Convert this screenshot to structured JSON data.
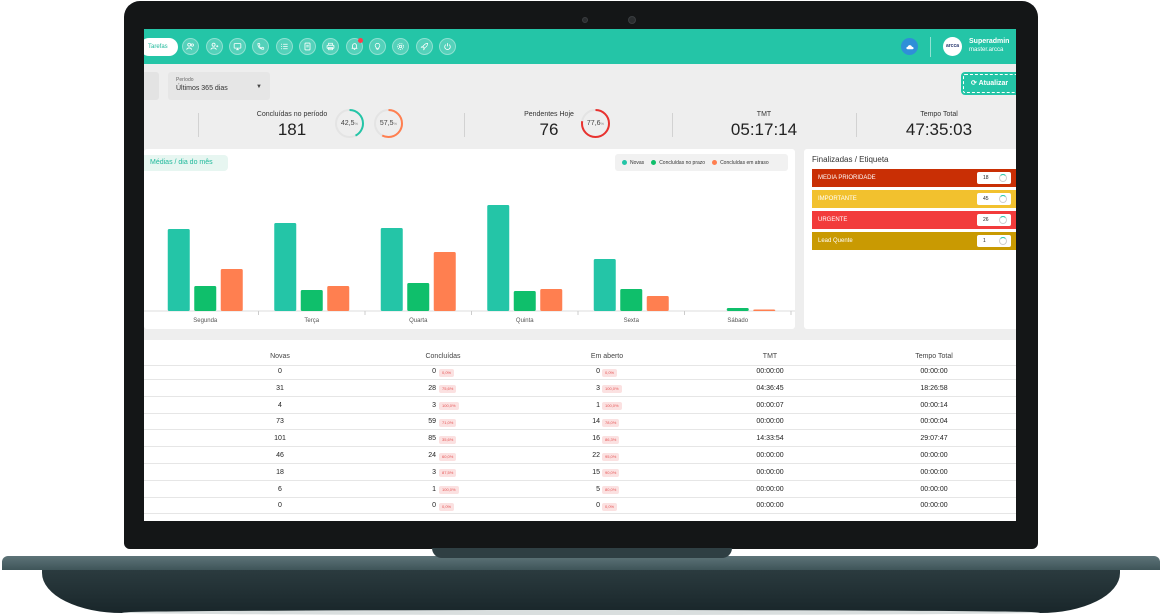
{
  "header": {
    "tasks_label": "Tarefas",
    "icons": [
      "users-icon",
      "user-plus-icon",
      "monitor-icon",
      "phone-icon",
      "list-icon",
      "document-icon",
      "printer-icon",
      "bell-icon",
      "lightbulb-icon",
      "settings-icon",
      "rocket-icon",
      "power-icon"
    ],
    "avatar_text": "arcca",
    "user_name": "Superadmin",
    "user_sub": "master.arcca"
  },
  "filter": {
    "period_label": "Período",
    "period_value": "Últimos 365 dias",
    "refresh_label": "Atualizar"
  },
  "stats": {
    "completed_label": "Concluídas no período",
    "completed_value": "181",
    "ring1_value": "42,5",
    "ring1_unit": "%",
    "ring2_value": "57,5",
    "ring2_unit": "%",
    "pending_label": "Pendentes Hoje",
    "pending_value": "76",
    "ring3_value": "77,6",
    "ring3_unit": "%",
    "tmt_label": "TMT",
    "tmt_value": "05:17:14",
    "total_label": "Tempo Total",
    "total_value": "47:35:03"
  },
  "colors": {
    "brand": "#24c5a7",
    "novas": "#24c5a7",
    "no_prazo": "#0fbf6b",
    "em_atraso": "#ff7f50",
    "ring_green": "#24c5a7",
    "ring_orange": "#ff7f50",
    "ring_red": "#e8322f"
  },
  "chart_data": {
    "type": "bar",
    "title": "Médias / dia do mês",
    "categories": [
      "Segunda",
      "Terça",
      "Quarta",
      "Quinta",
      "Sexta",
      "Sábado"
    ],
    "series": [
      {
        "name": "Novas",
        "values": [
          82,
          88,
          83,
          106,
          52,
          0
        ]
      },
      {
        "name": "Concluídas no prazo",
        "values": [
          25,
          21,
          28,
          20,
          22,
          3
        ]
      },
      {
        "name": "Concluídas em atraso",
        "values": [
          42,
          25,
          59,
          22,
          15,
          1
        ]
      }
    ],
    "legend_position": "top-right",
    "grid": false
  },
  "tags": {
    "title": "Finalizadas / Etiqueta",
    "items": [
      {
        "label": "MEDIA PRIORIDADE",
        "count": "18",
        "color": "#c92f05"
      },
      {
        "label": "IMPORTANTE",
        "count": "45",
        "color": "#f2c12e"
      },
      {
        "label": "URGENTE",
        "count": "26",
        "color": "#f23b3b"
      },
      {
        "label": "Lead Quente",
        "count": "1",
        "color": "#c99a02"
      }
    ]
  },
  "table": {
    "headers": [
      "Novas",
      "Concluídas",
      "Em aberto",
      "TMT",
      "Tempo Total"
    ],
    "rows": [
      {
        "novas": "0",
        "conc": "0",
        "conc_pct": "0,0%",
        "aberto": "0",
        "aberto_pct": "0,0%",
        "tmt": "00:00:00",
        "total": "00:00:00"
      },
      {
        "novas": "31",
        "conc": "28",
        "conc_pct": "75,6%",
        "aberto": "3",
        "aberto_pct": "100,0%",
        "tmt": "04:36:45",
        "total": "18:26:58"
      },
      {
        "novas": "4",
        "conc": "3",
        "conc_pct": "100,0%",
        "aberto": "1",
        "aberto_pct": "100,0%",
        "tmt": "00:00:07",
        "total": "00:00:14"
      },
      {
        "novas": "73",
        "conc": "59",
        "conc_pct": "71,0%",
        "aberto": "14",
        "aberto_pct": "78,0%",
        "tmt": "00:00:00",
        "total": "00:00:04"
      },
      {
        "novas": "101",
        "conc": "85",
        "conc_pct": "35,6%",
        "aberto": "16",
        "aberto_pct": "86,3%",
        "tmt": "14:33:54",
        "total": "29:07:47"
      },
      {
        "novas": "46",
        "conc": "24",
        "conc_pct": "60,0%",
        "aberto": "22",
        "aberto_pct": "95,0%",
        "tmt": "00:00:00",
        "total": "00:00:00"
      },
      {
        "novas": "18",
        "conc": "3",
        "conc_pct": "87,5%",
        "aberto": "15",
        "aberto_pct": "90,0%",
        "tmt": "00:00:00",
        "total": "00:00:00"
      },
      {
        "novas": "6",
        "conc": "1",
        "conc_pct": "100,0%",
        "aberto": "5",
        "aberto_pct": "80,0%",
        "tmt": "00:00:00",
        "total": "00:00:00"
      },
      {
        "novas": "0",
        "conc": "0",
        "conc_pct": "0,0%",
        "aberto": "0",
        "aberto_pct": "0,0%",
        "tmt": "00:00:00",
        "total": "00:00:00"
      }
    ]
  }
}
